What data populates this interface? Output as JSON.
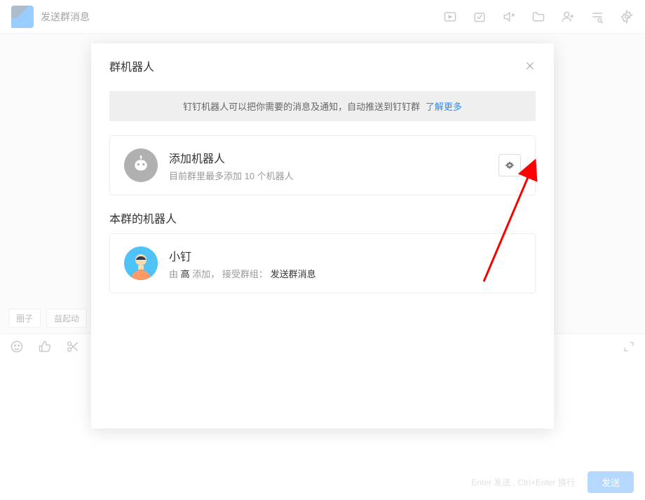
{
  "header": {
    "title": "发送群消息"
  },
  "tags": {
    "circle": "圈子",
    "yiqidong": "益起动"
  },
  "send": {
    "hint": "Enter 发送 , Ctrl+Enter 换行",
    "button": "发送"
  },
  "modal": {
    "title": "群机器人",
    "notice": "钉钉机器人可以把你需要的消息及通知，自动推送到钉钉群",
    "notice_link": "了解更多",
    "add_robot_title": "添加机器人",
    "add_robot_sub": "目前群里最多添加 10 个机器人",
    "section_title": "本群的机器人",
    "robots": [
      {
        "name": "小钉",
        "by_label": "由",
        "added_by": "高",
        "add_text": "添加，",
        "accept_label": "接受群组：",
        "group_name": "发送群消息"
      }
    ]
  }
}
